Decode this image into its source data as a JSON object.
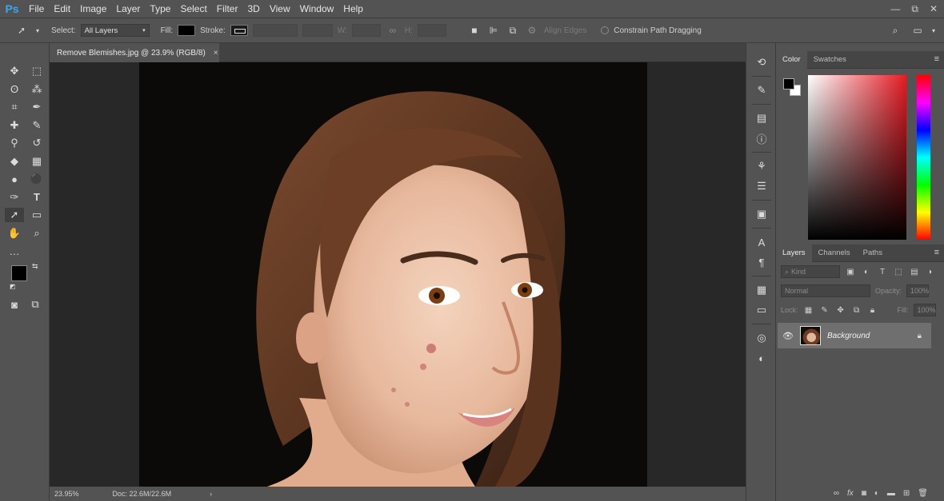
{
  "app": {
    "logo": "Ps"
  },
  "menu": {
    "items": [
      "File",
      "Edit",
      "Image",
      "Layer",
      "Type",
      "Select",
      "Filter",
      "3D",
      "View",
      "Window",
      "Help"
    ]
  },
  "window_controls": {
    "minimize": "—",
    "restore": "⧉",
    "close": "✕"
  },
  "options": {
    "select_label": "Select:",
    "select_value": "All Layers",
    "fill_label": "Fill:",
    "stroke_label": "Stroke:",
    "w_label": "W:",
    "h_label": "H:",
    "align_edges_label": "Align Edges",
    "constrain_label": "Constrain Path Dragging"
  },
  "document": {
    "tab_title": "Remove Blemishes.jpg @ 23.9% (RGB/8)",
    "close": "×",
    "zoom": "23.95%",
    "doc_size": "Doc: 22.6M/22.6M"
  },
  "color_panel": {
    "tabs": [
      "Color",
      "Swatches"
    ],
    "active": 0
  },
  "layers_panel": {
    "tabs": [
      "Layers",
      "Channels",
      "Paths"
    ],
    "active": 0,
    "kind_placeholder": "Kind",
    "blend_mode": "Normal",
    "opacity_label": "Opacity:",
    "opacity_value": "100%",
    "lock_label": "Lock:",
    "fill_label": "Fill:",
    "fill_value": "100%",
    "layers": [
      {
        "name": "Background",
        "visible": true,
        "locked": true
      }
    ]
  },
  "colors": {
    "foreground": "#000000",
    "background": "#ffffff",
    "app_bg": "#535353"
  }
}
